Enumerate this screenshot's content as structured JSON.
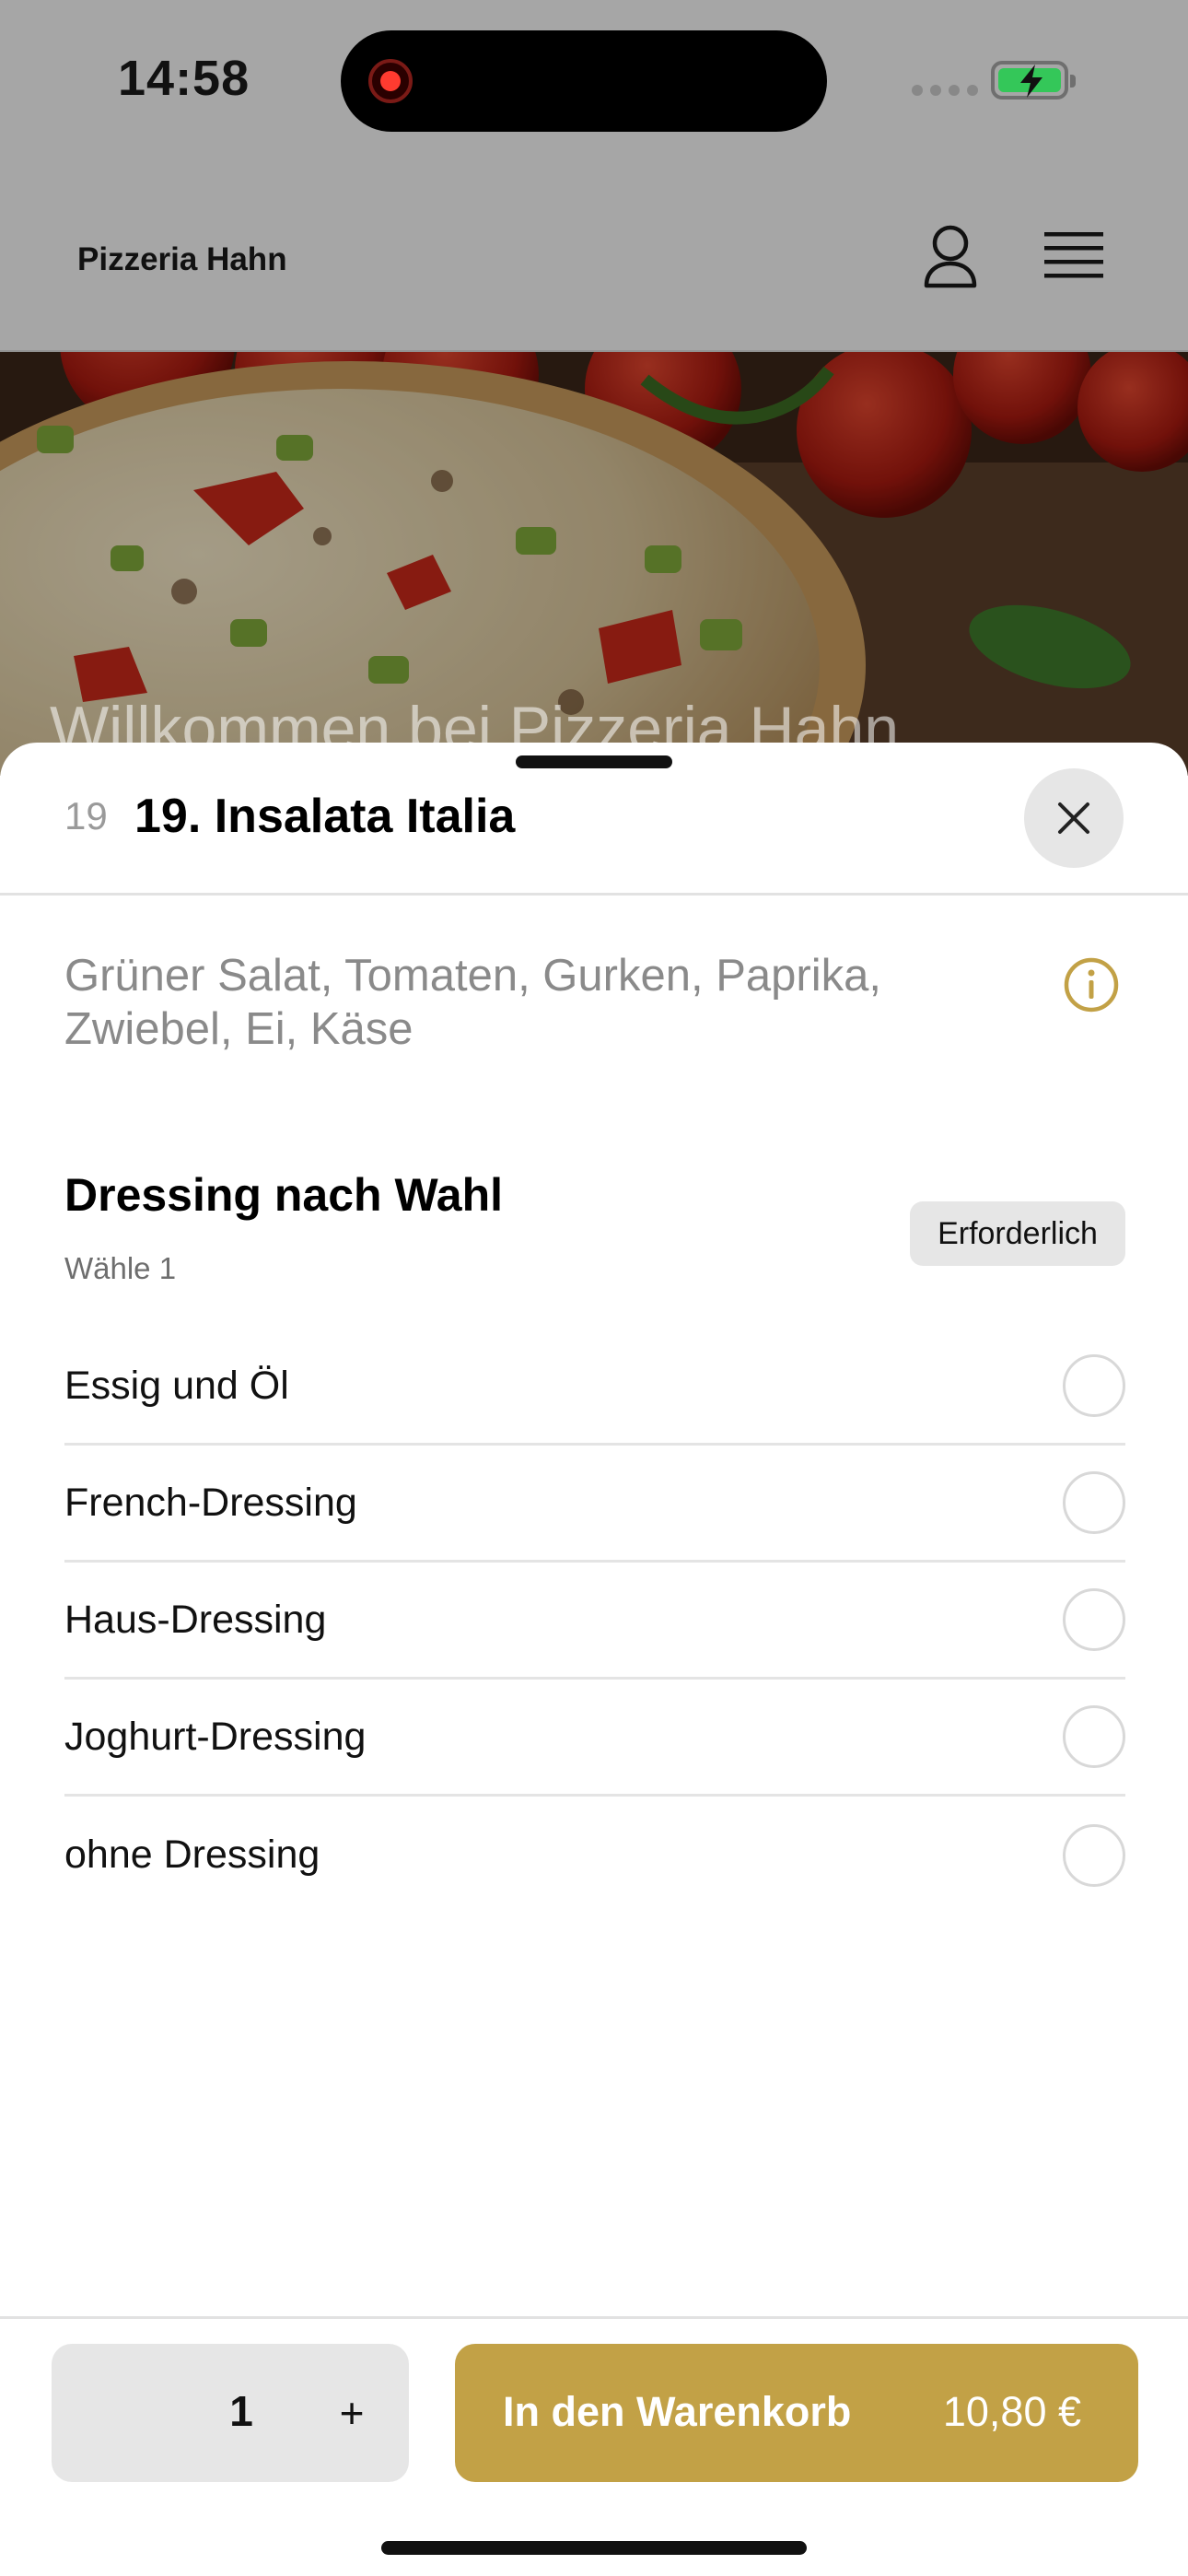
{
  "status_bar": {
    "time": "14:58"
  },
  "app_header": {
    "brand": "Pizzeria Hahn"
  },
  "hero": {
    "title": "Willkommen bei Pizzeria Hahn"
  },
  "item": {
    "number": "19",
    "title": "19. Insalata Italia",
    "description": "Grüner Salat, Tomaten, Gurken, Paprika, Zwiebel, Ei, Käse"
  },
  "options_group": {
    "title": "Dressing nach Wahl",
    "subtitle": "Wähle 1",
    "badge": "Erforderlich",
    "options": [
      {
        "label": "Essig und Öl",
        "selected": false
      },
      {
        "label": "French-Dressing",
        "selected": false
      },
      {
        "label": "Haus-Dressing",
        "selected": false
      },
      {
        "label": "Joghurt-Dressing",
        "selected": false
      },
      {
        "label": "ohne Dressing",
        "selected": false
      }
    ]
  },
  "footer": {
    "quantity": "1",
    "plus_label": "+",
    "cart_label": "In den Warenkorb",
    "price": "10,80 €"
  },
  "colors": {
    "accent": "#c2a146",
    "overlay_gray": "#a6a6a6",
    "battery_green": "#34c759",
    "record_red": "#ff3b30"
  },
  "icons": {
    "user": "user-icon",
    "menu": "menu-icon",
    "close": "close-icon",
    "info": "info-icon"
  }
}
